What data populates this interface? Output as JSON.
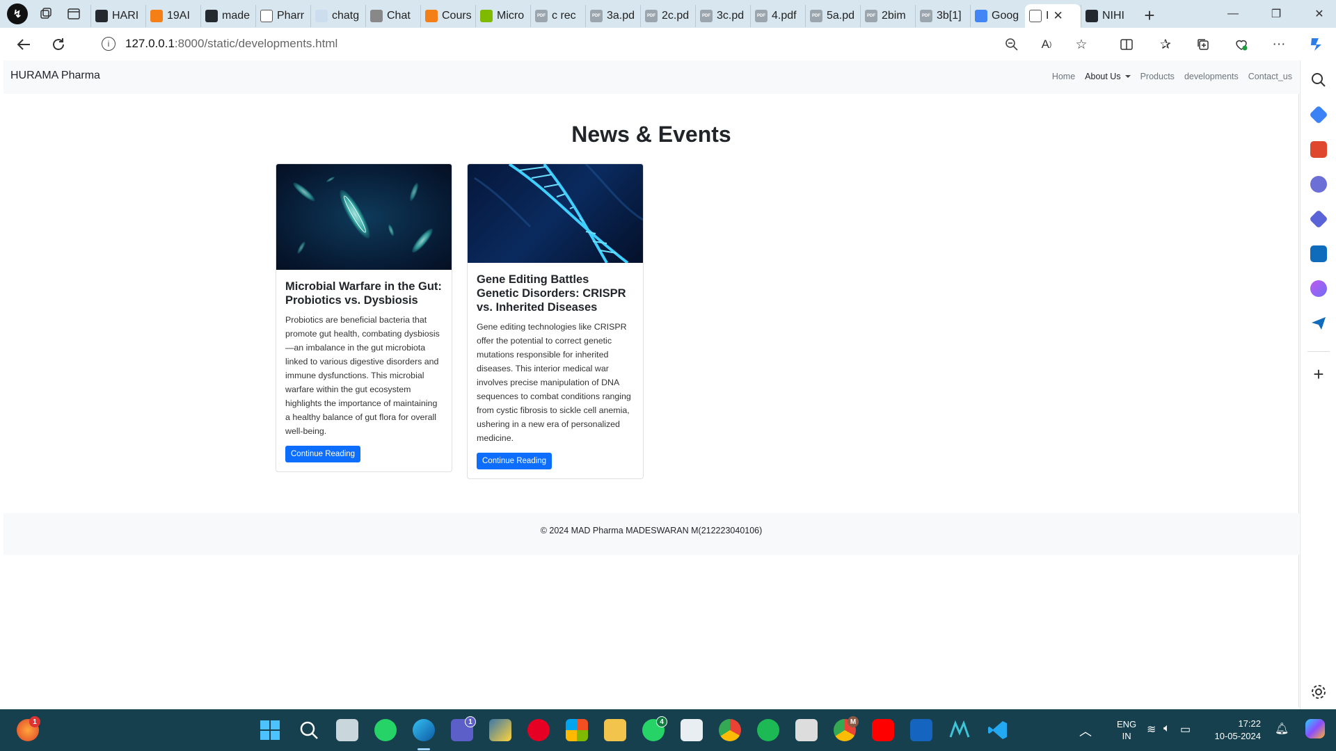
{
  "browser": {
    "tabs": [
      {
        "label": "HARI",
        "fav": "github"
      },
      {
        "label": "19AI",
        "fav": "hand"
      },
      {
        "label": "made",
        "fav": "github"
      },
      {
        "label": "Pharr",
        "fav": "page"
      },
      {
        "label": "chatg",
        "fav": "search"
      },
      {
        "label": "Chat",
        "fav": "openai"
      },
      {
        "label": "Cours",
        "fav": "hand"
      },
      {
        "label": "Micro",
        "fav": "ms"
      },
      {
        "label": "c rec",
        "fav": "pdf"
      },
      {
        "label": "3a.pd",
        "fav": "pdf"
      },
      {
        "label": "2c.pd",
        "fav": "pdf"
      },
      {
        "label": "3c.pd",
        "fav": "pdf"
      },
      {
        "label": "4.pdf",
        "fav": "pdf"
      },
      {
        "label": "5a.pd",
        "fav": "pdf"
      },
      {
        "label": "2bim",
        "fav": "pdf"
      },
      {
        "label": "3b[1]",
        "fav": "pdf"
      },
      {
        "label": "Goog",
        "fav": "google"
      },
      {
        "label": "I",
        "fav": "page",
        "active": true
      },
      {
        "label": "NIHI",
        "fav": "github"
      }
    ],
    "url_host": "127.0.0.1",
    "url_path": ":8000/static/developments.html"
  },
  "site": {
    "brand": "HURAMA Pharma",
    "nav": {
      "home": "Home",
      "about": "About Us",
      "products": "Products",
      "developments": "developments",
      "contact": "Contact_us"
    },
    "title": "News & Events",
    "cards": [
      {
        "title": "Microbial Warfare in the Gut: Probiotics vs. Dysbiosis",
        "text": "Probiotics are beneficial bacteria that promote gut health, combating dysbiosis—an imbalance in the gut microbiota linked to various digestive disorders and immune dysfunctions. This microbial warfare within the gut ecosystem highlights the importance of maintaining a healthy balance of gut flora for overall well-being.",
        "button": "Continue Reading"
      },
      {
        "title": "Gene Editing Battles Genetic Disorders: CRISPR vs. Inherited Diseases",
        "text": "Gene editing technologies like CRISPR offer the potential to correct genetic mutations responsible for inherited diseases. This interior medical war involves precise manipulation of DNA sequences to combat conditions ranging from cystic fibrosis to sickle cell anemia, ushering in a new era of personalized medicine.",
        "button": "Continue Reading"
      }
    ],
    "footer": "© 2024 MAD Pharma MADESWARAN M(212223040106)"
  },
  "taskbar": {
    "lang_top": "ENG",
    "lang_bottom": "IN",
    "time": "17:22",
    "date": "10-05-2024",
    "badges": {
      "firefox": "1",
      "teams": "1",
      "whatsapp": "4",
      "chrome_profile": "M"
    }
  },
  "colors": {
    "accent": "#0d6efd",
    "navbar_bg": "#f8f9fa",
    "tabbar_bg": "#d8e6ef",
    "taskbar_bg": "#17404f"
  }
}
